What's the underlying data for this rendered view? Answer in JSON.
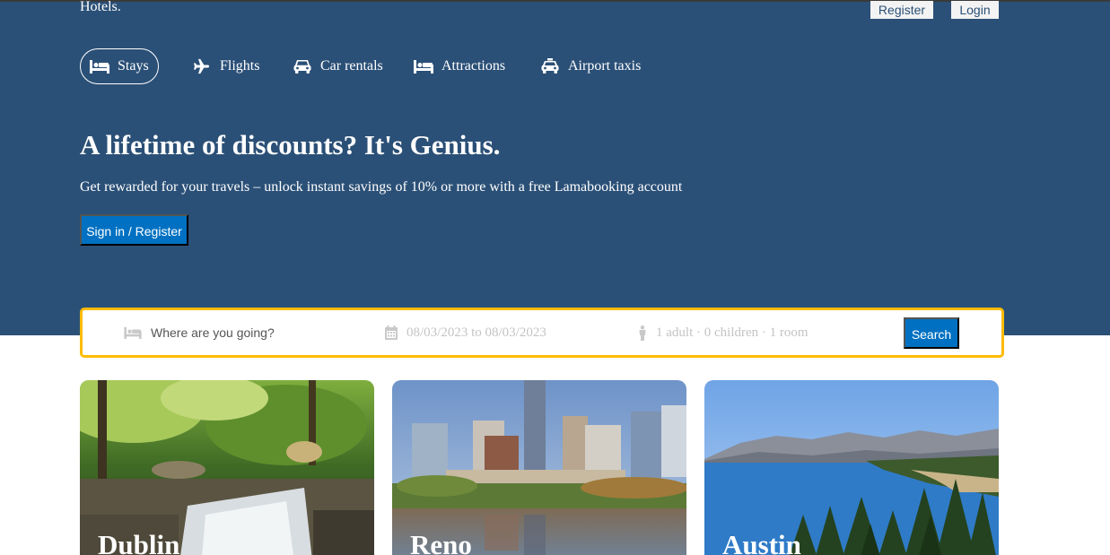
{
  "brand": "Hotels.",
  "auth": {
    "register": "Register",
    "login": "Login"
  },
  "nav": [
    {
      "label": "Stays",
      "icon": "bed-icon",
      "active": true
    },
    {
      "label": "Flights",
      "icon": "plane-icon",
      "active": false
    },
    {
      "label": "Car rentals",
      "icon": "car-icon",
      "active": false
    },
    {
      "label": "Attractions",
      "icon": "bed-icon",
      "active": false
    },
    {
      "label": "Airport taxis",
      "icon": "taxi-icon",
      "active": false
    }
  ],
  "hero": {
    "title": "A lifetime of discounts? It's Genius.",
    "description": "Get rewarded for your travels – unlock instant savings of 10% or more with a free Lamabooking account",
    "cta": "Sign in / Register"
  },
  "search": {
    "destination_placeholder": "Where are you going?",
    "dates": "08/03/2023 to 08/03/2023",
    "guests": "1 adult · 0 children · 1 room",
    "button": "Search"
  },
  "featured": [
    {
      "city": "Dublin"
    },
    {
      "city": "Reno"
    },
    {
      "city": "Austin"
    }
  ],
  "colors": {
    "header_bg": "#2b5077",
    "accent": "#0071c2",
    "search_border": "#febb02"
  }
}
